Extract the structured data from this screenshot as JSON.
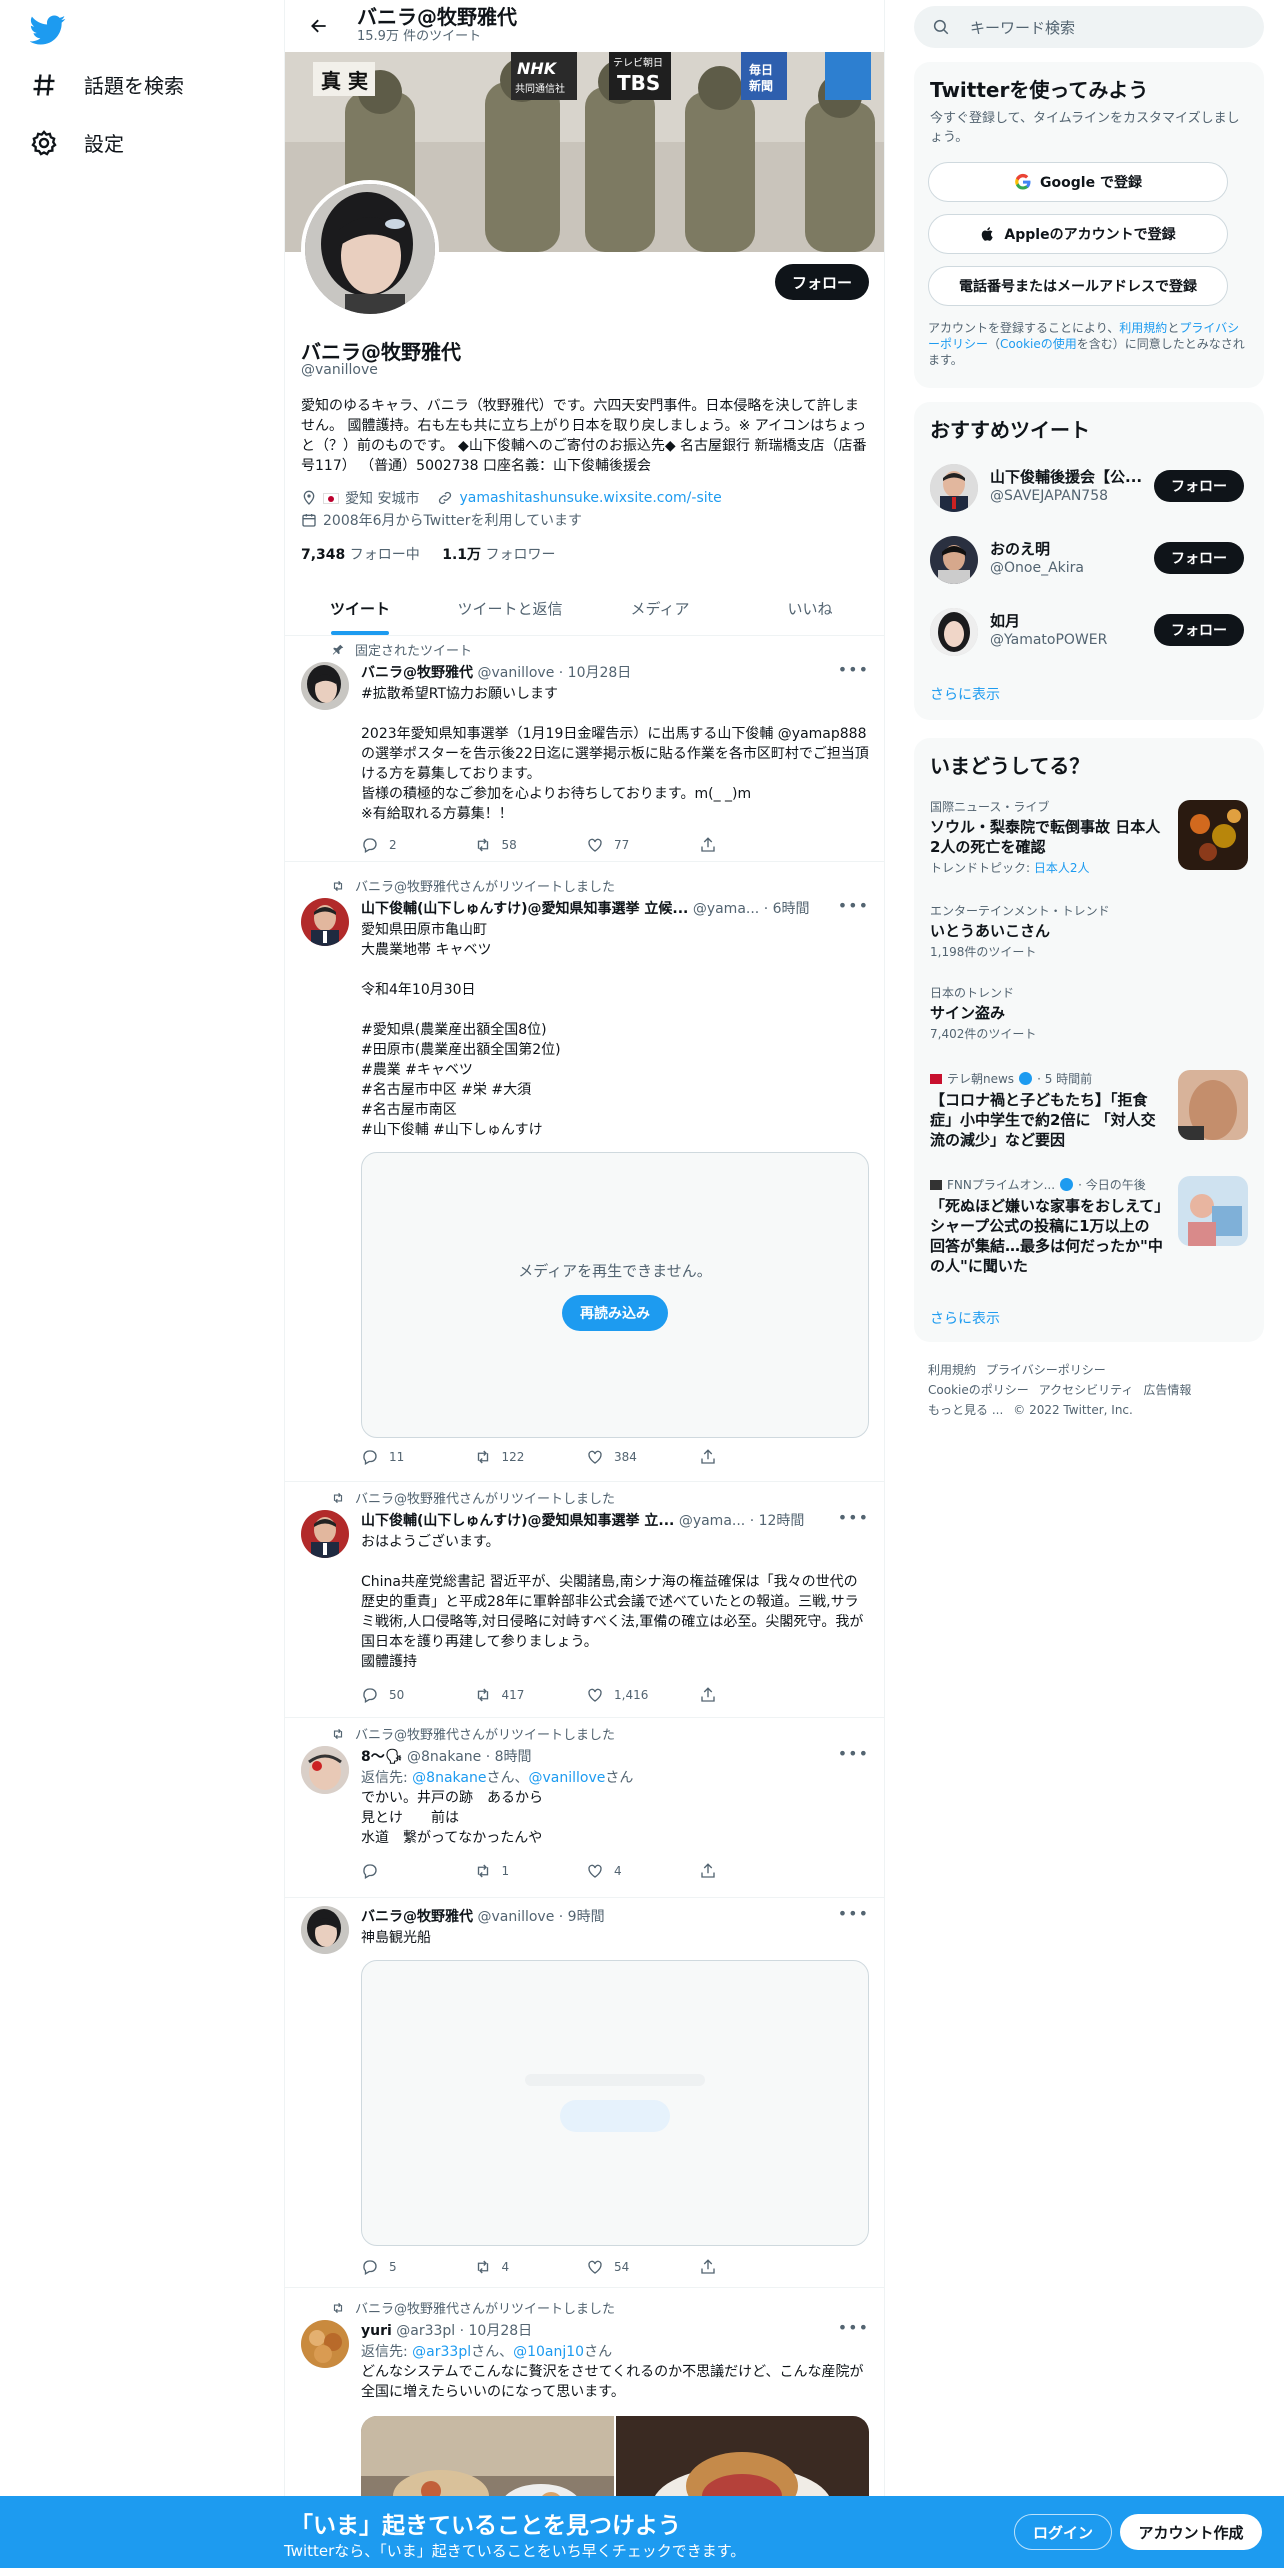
{
  "leftnav": {
    "items": [
      {
        "label": "話題を検索"
      },
      {
        "label": "設定"
      }
    ]
  },
  "header": {
    "title": "バニラ@牧野雅代",
    "tweet_count": "15.9万 件のツイート"
  },
  "banner": {
    "labels": [
      "真 実",
      "NHK",
      "共同通信社",
      "テレビ朝日",
      "TBS",
      "毎日",
      "新聞"
    ]
  },
  "profile": {
    "follow_label": "フォロー",
    "name": "バニラ@牧野雅代",
    "handle": "@vanillove",
    "bio": "愛知のゆるキャラ、バニラ（牧野雅代）です。六四天安門事件。日本侵略を決して許しません。 國體護持。右も左も共に立ち上がり日本を取り戻しましょう。※ アイコンはちょっと（？）前のものです。 ◆山下俊輔へのご寄付のお振込先◆ 名古屋銀行 新瑞橋支店（店番号117） （普通）5002738 口座名義：山下俊輔後援会",
    "location": "愛知 安城市",
    "website": "yamashitashunsuke.wixsite.com/-site",
    "joined": "2008年6月からTwitterを利用しています",
    "following_count": "7,348",
    "following_label": "フォロー中",
    "followers_count": "1.1万",
    "followers_label": "フォロワー"
  },
  "tabs": [
    {
      "label": "ツイート"
    },
    {
      "label": "ツイートと返信"
    },
    {
      "label": "メディア"
    },
    {
      "label": "いいね"
    }
  ],
  "tweets": [
    {
      "context": "固定されたツイート",
      "name": "バニラ@牧野雅代",
      "meta": "@vanillove · 10月28日",
      "body": "#拡散希望RT協力お願いします\n\n2023年愛知県知事選挙（1月19日金曜告示）に出馬する山下俊輔 @yamap888 の選挙ポスターを告示後22日迄に選挙掲示板に貼る作業を各市区町村でご担当頂ける方を募集しております。\n皆様の積極的なご参加を心よりお待ちしております。m(_ _)m\n※有給取れる方募集！！",
      "replies": "2",
      "retweets": "58",
      "likes": "77"
    },
    {
      "context": "バニラ@牧野雅代さんがリツイートしました",
      "name": "山下俊輔(山下しゅんすけ)@愛知県知事選挙 立候...",
      "meta": "@yama... · 6時間",
      "body": "愛知県田原市亀山町\n大農業地帯 キャベツ\n\n令和4年10月30日\n\n#愛知県(農業産出額全国8位)\n#田原市(農業産出額全国第2位)\n#農業 #キャベツ\n#名古屋市中区 #栄 #大須\n#名古屋市南区\n#山下俊輔 #山下しゅんすけ",
      "media_msg": "メディアを再生できません。",
      "media_btn": "再読み込み",
      "replies": "11",
      "retweets": "122",
      "likes": "384"
    },
    {
      "context": "バニラ@牧野雅代さんがリツイートしました",
      "name": "山下俊輔(山下しゅんすけ)@愛知県知事選挙 立...",
      "meta": "@yama... · 12時間",
      "body": "おはようございます。\n\nChina共産党総書記 習近平が、尖閣諸島,南シナ海の権益確保は「我々の世代の歴史的重責」と平成28年に軍幹部非公式会議で述べていたとの報道。三戦,サラミ戦術,人口侵略等,対日侵略に対峙すべく法,軍備の確立は必至。尖閣死守。我が国日本を護り再建して参りましょう。\n國體護持",
      "replies": "50",
      "retweets": "417",
      "likes": "1,416"
    },
    {
      "context": "バニラ@牧野雅代さんがリツイートしました",
      "name": "8〜🗣",
      "meta": "@8nakane · 8時間",
      "reply_to_prefix": "返信先: ",
      "reply_to_1": "@8nakane",
      "reply_to_mid": "さん、",
      "reply_to_2": "@vanillove",
      "reply_to_suffix": "さん",
      "body": "でかい。井戸の跡　あるから\n見とけ　　前は\n水道　繋がってなかったんや",
      "replies": "",
      "retweets": "1",
      "likes": "4"
    },
    {
      "context": "",
      "name": "バニラ@牧野雅代",
      "meta": "@vanillove · 9時間",
      "body": "神島観光船",
      "replies": "5",
      "retweets": "4",
      "likes": "54"
    },
    {
      "context": "バニラ@牧野雅代さんがリツイートしました",
      "name": "yuri",
      "meta": "@ar33pl · 10月28日",
      "reply_to_prefix": "返信先: ",
      "reply_to_1": "@ar33pl",
      "reply_to_mid": "さん、",
      "reply_to_2": "@10anj10",
      "reply_to_suffix": "さん",
      "body": "どんなシステムでこんなに贅沢をさせてくれるのか不思議だけど、こんな産院が全国に増えたらいいのになって思います。"
    }
  ],
  "right": {
    "search_placeholder": "キーワード検索",
    "signup": {
      "title": "Twitterを使ってみよう",
      "sub": "今すぐ登録して、タイムラインをカスタマイズしましょう。",
      "google": "Google で登録",
      "apple": "Appleのアカウントで登録",
      "phone": "電話番号またはメールアドレスで登録",
      "legal_1": "アカウントを登録することにより、",
      "legal_link1": "利用規約",
      "legal_2": "と",
      "legal_link2": "プライバシーポリシー",
      "legal_3": "（",
      "legal_link3": "Cookieの使用",
      "legal_4": "を含む）に同意したとみなされます。"
    },
    "recommended": {
      "title": "おすすめツイート",
      "users": [
        {
          "name": "山下俊輔後援会【公...",
          "handle": "@SAVEJAPAN758",
          "follow": "フォロー"
        },
        {
          "name": "おのえ明",
          "handle": "@Onoe_Akira",
          "follow": "フォロー"
        },
        {
          "name": "如月",
          "handle": "@YamatoPOWER",
          "follow": "フォロー"
        }
      ],
      "more": "さらに表示"
    },
    "trends": {
      "title": "いまどうしてる？",
      "items": [
        {
          "cat": "国際ニュース・ライブ",
          "title": "ソウル・梨泰院で転倒事故 日本人2人の死亡を確認",
          "sub_prefix": "トレンドトピック: ",
          "sub_link": "日本人2人"
        },
        {
          "cat": "エンターテインメント・トレンド",
          "title": "いとうあいこさん",
          "count": "1,198件のツイート"
        },
        {
          "cat": "日本のトレンド",
          "title": "サイン盗み",
          "count": "7,402件のツイート"
        }
      ],
      "news": [
        {
          "source": "テレ朝news",
          "time": "· 5 時間前",
          "title": "【コロナ禍と子どもたち】「拒食症」小中学生で約2倍に 「対人交流の減少」など要因"
        },
        {
          "source": "FNNプライムオン...",
          "time": "· 今日の午後",
          "title": "「死ぬほど嫌いな家事をおしえて」シャープ公式の投稿に1万以上の回答が集結…最多は何だったか\"中の人\"に聞いた"
        }
      ],
      "more": "さらに表示"
    },
    "footer": {
      "links": [
        "利用規約",
        "プライバシーポリシー",
        "Cookieのポリシー",
        "アクセシビリティ",
        "広告情報",
        "もっと見る ...",
        "© 2022 Twitter, Inc."
      ]
    }
  },
  "bottombar": {
    "headline": "「いま」起きていることを見つけよう",
    "sub": "Twitterなら、「いま」起きていることをいち早くチェックできます。",
    "login": "ログイン",
    "signup": "アカウント作成"
  },
  "colors": {
    "accent": "#1d9bf0",
    "text": "#0f1419",
    "muted": "#536471"
  }
}
